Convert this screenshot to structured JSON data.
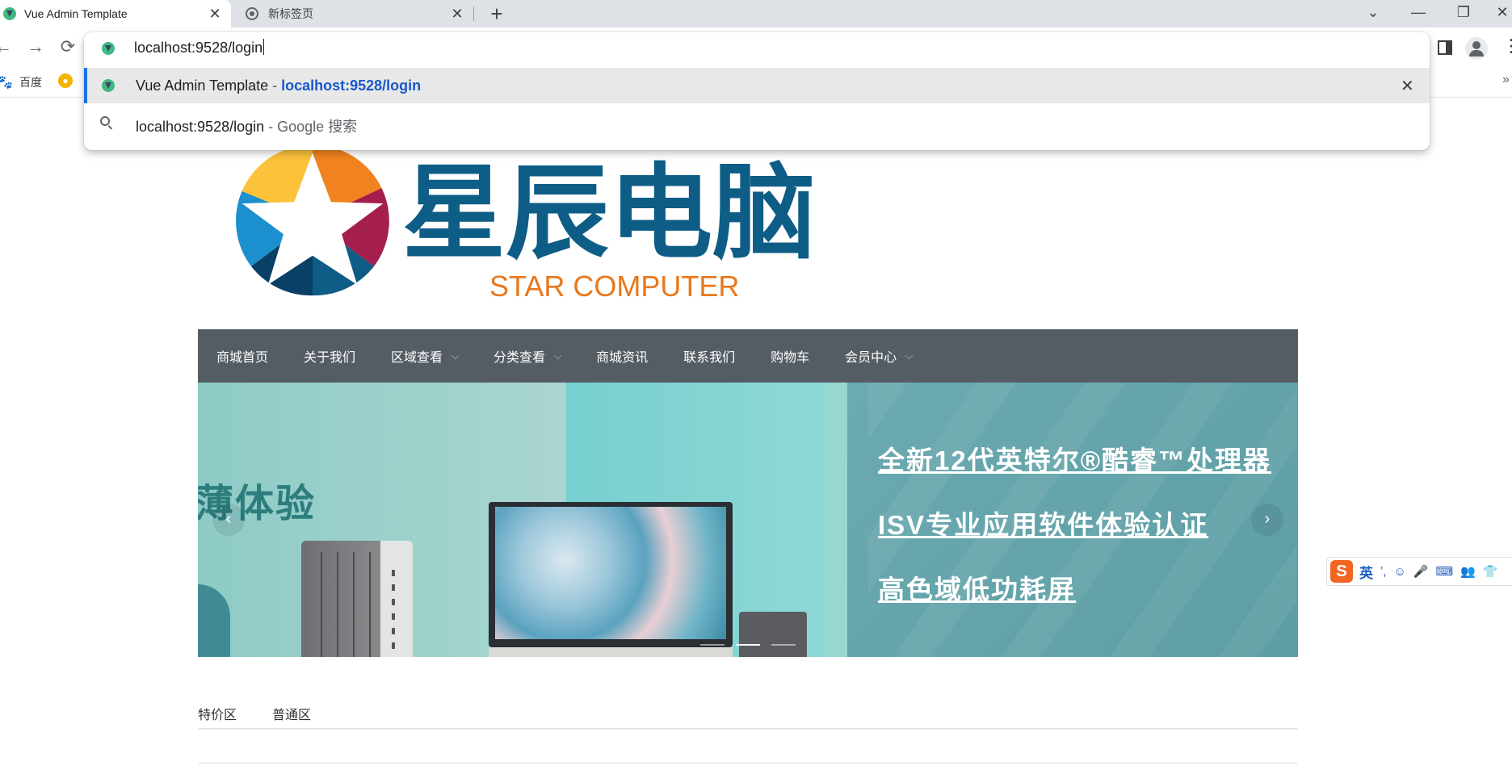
{
  "browser": {
    "tabs": [
      {
        "title": "Vue Admin Template",
        "active": true
      },
      {
        "title": "新标签页",
        "active": false
      }
    ],
    "new_tab": "+",
    "window_controls": {
      "menu": "⌄",
      "minimize": "—",
      "restore": "❐",
      "close": "✕"
    },
    "nav": {
      "back": "←",
      "forward": "→",
      "reload": "⟳"
    },
    "bookmarks": [
      {
        "label": "百度",
        "icon": "paw-icon"
      },
      {
        "label": "",
        "icon": "lion-icon"
      }
    ],
    "bookmarks_more": "»",
    "omnibox": {
      "value": "localhost:9528/login",
      "suggestions": [
        {
          "title": "Vue Admin Template",
          "separator": " - ",
          "url": "localhost:9528/login",
          "icon": "vue-icon"
        },
        {
          "title": "localhost:9528/login",
          "separator": " - ",
          "suffix": "Google 搜索",
          "icon": "search-icon"
        }
      ],
      "remove": "✕"
    },
    "menu": "⋮"
  },
  "site": {
    "logo": {
      "cn": "星辰电脑",
      "en": "STAR COMPUTER"
    },
    "nav": [
      {
        "label": "商城首页",
        "dropdown": false
      },
      {
        "label": "关于我们",
        "dropdown": false
      },
      {
        "label": "区域查看",
        "dropdown": true
      },
      {
        "label": "分类查看",
        "dropdown": true
      },
      {
        "label": "商城资讯",
        "dropdown": false
      },
      {
        "label": "联系我们",
        "dropdown": false
      },
      {
        "label": "购物车",
        "dropdown": false
      },
      {
        "label": "会员中心",
        "dropdown": true
      }
    ],
    "carousel": {
      "slogan": "薄体验",
      "features": [
        "全新12代英特尔®酷睿™处理器",
        "ISV专业应用软件体验认证",
        "高色域低功耗屏"
      ],
      "prev": "‹",
      "next": "›",
      "indicator_count": 3,
      "active_index": 1
    },
    "category_tabs": [
      "特价区",
      "普通区"
    ]
  },
  "ime": {
    "logo": "S",
    "lang": "英",
    "icons": [
      "ʼ,",
      "☺",
      "🎤",
      "⌨",
      "👥",
      "👕"
    ]
  },
  "colors": {
    "nav_bg": "#545c64",
    "accent_blue": "#1a73e8",
    "logo_blue": "#0e5d86",
    "logo_orange": "#e8781c"
  }
}
